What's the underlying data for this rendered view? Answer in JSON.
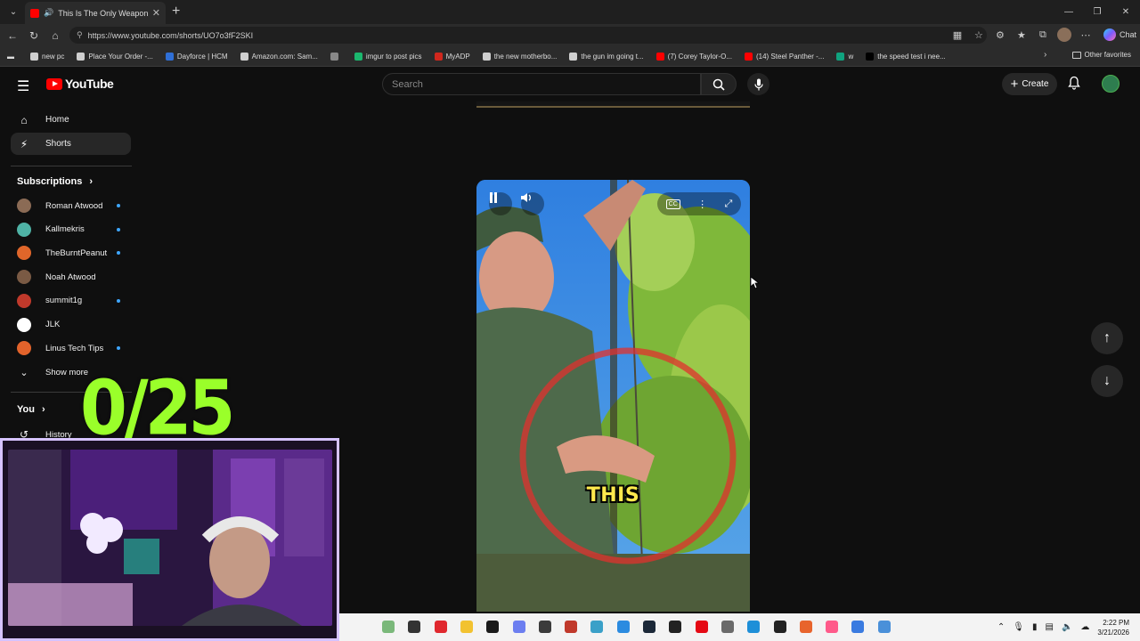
{
  "browser": {
    "tab": {
      "title": "This Is The Only Weapon In H"
    },
    "url": "https://www.youtube.com/shorts/UO7o3fF2SKI",
    "copilot_label": "Chat",
    "bookmarks": [
      {
        "label": "new pc",
        "color": "#cfcfcf"
      },
      {
        "label": "Place Your Order -...",
        "color": "#cfcfcf"
      },
      {
        "label": "Dayforce | HCM",
        "color": "#2f6fd6"
      },
      {
        "label": "Amazon.com: Sam...",
        "color": "#cfcfcf"
      },
      {
        "label": "",
        "color": "#888888"
      },
      {
        "label": "imgur to post pics",
        "color": "#1bb76e"
      },
      {
        "label": "MyADP",
        "color": "#d0271d"
      },
      {
        "label": "the new motherbo...",
        "color": "#cfcfcf"
      },
      {
        "label": "the gun im going t...",
        "color": "#cfcfcf"
      },
      {
        "label": "(7) Corey Taylor-O...",
        "color": "#ff0000"
      },
      {
        "label": "(14) Steel Panther -...",
        "color": "#ff0000"
      },
      {
        "label": "w",
        "color": "#10a37f"
      },
      {
        "label": "the speed test i nee...",
        "color": "#000000"
      }
    ],
    "other_favorites": "Other favorites"
  },
  "youtube": {
    "logo_text": "YouTube",
    "search_placeholder": "Search",
    "create_label": "Create",
    "sidebar": {
      "home": "Home",
      "shorts": "Shorts",
      "subscriptions_heading": "Subscriptions",
      "subscriptions": [
        {
          "name": "Roman Atwood",
          "color": "#8b6b55",
          "new": true
        },
        {
          "name": "Kallmekris",
          "color": "#4fb3a6",
          "new": true
        },
        {
          "name": "TheBurntPeanut",
          "color": "#e0662a",
          "new": true
        },
        {
          "name": "Noah Atwood",
          "color": "#7a5a44",
          "new": false
        },
        {
          "name": "summit1g",
          "color": "#c0392b",
          "new": true
        },
        {
          "name": "JLK",
          "color": "#ffffff",
          "new": false
        },
        {
          "name": "Linus Tech Tips",
          "color": "#e2632b",
          "new": true
        }
      ],
      "show_more": "Show more",
      "you_heading": "You",
      "history": "History"
    },
    "short": {
      "caption": "THIS"
    }
  },
  "overlay": {
    "counter": "0/25"
  },
  "taskbar": {
    "time": "2:22 PM",
    "date": "3/21/2026"
  }
}
